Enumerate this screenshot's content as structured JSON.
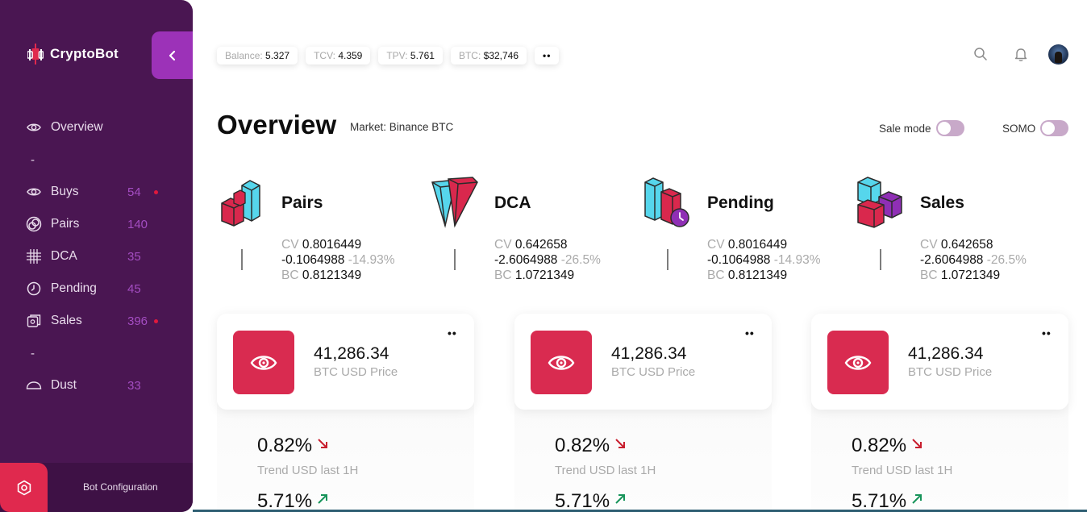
{
  "app": {
    "name": "CryptoBot"
  },
  "sidebar": {
    "items": [
      {
        "label": "Overview",
        "count": "",
        "icon": "eye-icon"
      },
      {
        "label": "Buys",
        "count": "54",
        "icon": "eye-icon",
        "alert": true
      },
      {
        "label": "Pairs",
        "count": "140",
        "icon": "pairs-icon"
      },
      {
        "label": "DCA",
        "count": "35",
        "icon": "grid-icon"
      },
      {
        "label": "Pending",
        "count": "45",
        "icon": "clock-icon"
      },
      {
        "label": "Sales",
        "count": "396",
        "icon": "sales-icon",
        "alert": true
      },
      {
        "label": "Dust",
        "count": "33",
        "icon": "cloud-icon"
      }
    ],
    "separator": "-",
    "bot_config_label": "Bot Configuration"
  },
  "topbar": {
    "pills": [
      {
        "key": "Balance:",
        "value": "5.327"
      },
      {
        "key": "TCV:",
        "value": "4.359"
      },
      {
        "key": "TPV:",
        "value": "5.761"
      },
      {
        "key": "BTC:",
        "value": "$32,746"
      }
    ],
    "more_label": "••"
  },
  "header": {
    "title": "Overview",
    "market": "Market: Binance BTC",
    "toggles": [
      {
        "label": "Sale mode",
        "on": false
      },
      {
        "label": "SOMO",
        "on": false
      }
    ]
  },
  "stats": [
    {
      "title": "Pairs",
      "cv_label": "CV",
      "cv": "0.8016449",
      "diff": "-0.1064988",
      "pct": "-14.93%",
      "bc_label": "BC",
      "bc": "0.8121349"
    },
    {
      "title": "DCA",
      "cv_label": "CV",
      "cv": "0.642658",
      "diff": "-2.6064988",
      "pct": "-26.5%",
      "bc_label": "BC",
      "bc": "1.0721349"
    },
    {
      "title": "Pending",
      "cv_label": "CV",
      "cv": "0.8016449",
      "diff": "-0.1064988",
      "pct": "-14.93%",
      "bc_label": "BC",
      "bc": "0.8121349"
    },
    {
      "title": "Sales",
      "cv_label": "CV",
      "cv": "0.642658",
      "diff": "-2.6064988",
      "pct": "-26.5%",
      "bc_label": "BC",
      "bc": "1.0721349"
    }
  ],
  "cards": [
    {
      "price": "41,286.34",
      "price_label": "BTC USD Price",
      "menu": "••",
      "trend1": "0.82%",
      "trend1_label": "Trend USD last 1H",
      "trend2": "5.71%"
    },
    {
      "price": "41,286.34",
      "price_label": "BTC USD Price",
      "menu": "••",
      "trend1": "0.82%",
      "trend1_label": "Trend USD last 1H",
      "trend2": "5.71%"
    },
    {
      "price": "41,286.34",
      "price_label": "BTC USD Price",
      "menu": "••",
      "trend1": "0.82%",
      "trend1_label": "Trend USD last 1H",
      "trend2": "5.71%"
    }
  ],
  "colors": {
    "sidebar": "#4a1652",
    "accent": "#9c32b8",
    "brand_red": "#d92b50",
    "trend_down": "#c81e2e",
    "trend_up": "#17945a"
  }
}
